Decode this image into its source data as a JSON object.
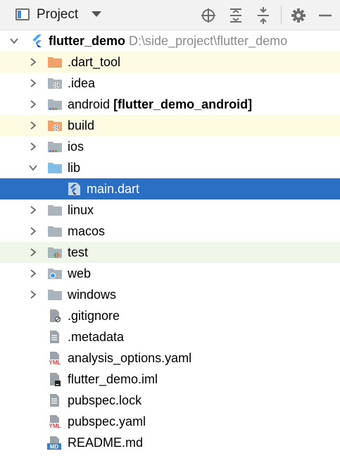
{
  "toolbar": {
    "title": "Project",
    "icons": [
      "project-view-icon",
      "dropdown-arrow-icon",
      "locate-icon",
      "expand-all-icon",
      "collapse-all-icon",
      "settings-gear-icon",
      "hide-icon"
    ]
  },
  "tree": {
    "root": {
      "name": "flutter_demo",
      "path": "D:\\side_project\\flutter_demo",
      "icon": "flutter-icon"
    },
    "rows": [
      {
        "name": ".dart_tool",
        "icon": "folder-excluded-icon",
        "state": "excluded"
      },
      {
        "name": ".idea",
        "icon": "folder-idea-icon"
      },
      {
        "name": "android",
        "module": "[flutter_demo_android]",
        "icon": "folder-module-icon"
      },
      {
        "name": "build",
        "icon": "folder-excluded-icon",
        "state": "excluded"
      },
      {
        "name": "ios",
        "icon": "folder-module-icon"
      },
      {
        "name": "lib",
        "icon": "folder-source-icon",
        "expanded": true
      },
      {
        "name": "main.dart",
        "icon": "dart-file-icon",
        "state": "selected"
      },
      {
        "name": "linux",
        "icon": "folder-icon"
      },
      {
        "name": "macos",
        "icon": "folder-icon"
      },
      {
        "name": "test",
        "icon": "folder-test-icon",
        "state": "test"
      },
      {
        "name": "web",
        "icon": "folder-web-icon"
      },
      {
        "name": "windows",
        "icon": "folder-icon"
      },
      {
        "name": ".gitignore",
        "icon": "gitignore-file-icon"
      },
      {
        "name": ".metadata",
        "icon": "text-file-icon"
      },
      {
        "name": "analysis_options.yaml",
        "icon": "yaml-file-icon"
      },
      {
        "name": "flutter_demo.iml",
        "icon": "iml-file-icon"
      },
      {
        "name": "pubspec.lock",
        "icon": "text-file-icon"
      },
      {
        "name": "pubspec.yaml",
        "icon": "yaml-file-icon"
      },
      {
        "name": "README.md",
        "icon": "markdown-file-icon"
      }
    ]
  },
  "colors": {
    "selected": "#2a6fc4",
    "excluded": "#fdfbe2",
    "test": "#eff7ea",
    "folder": "#aab4bd",
    "excluded_folder": "#f0a26a",
    "source_folder": "#7fbde8"
  }
}
